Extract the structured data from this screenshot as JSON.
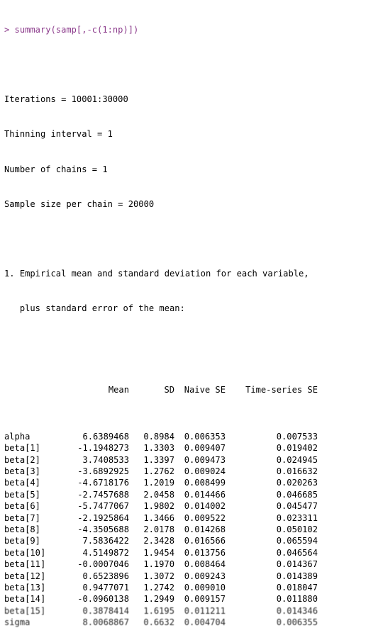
{
  "command": "> summary(samp[,-c(1:np)])",
  "header": [
    "Iterations = 10001:30000",
    "Thinning interval = 1",
    "Number of chains = 1",
    "Sample size per chain = 20000"
  ],
  "section": {
    "line1": "1. Empirical mean and standard deviation for each variable,",
    "line2": "   plus standard error of the mean:"
  },
  "table": {
    "columns": [
      "",
      "Mean",
      "SD",
      "Naive SE",
      "Time-series SE"
    ],
    "rows": [
      [
        "alpha",
        "6.6389468",
        "0.8984",
        "0.006353",
        "0.007533"
      ],
      [
        "beta[1]",
        "-1.1948273",
        "1.3303",
        "0.009407",
        "0.019402"
      ],
      [
        "beta[2]",
        "3.7408533",
        "1.3397",
        "0.009473",
        "0.024945"
      ],
      [
        "beta[3]",
        "-3.6892925",
        "1.2762",
        "0.009024",
        "0.016632"
      ],
      [
        "beta[4]",
        "-4.6718176",
        "1.2019",
        "0.008499",
        "0.020263"
      ],
      [
        "beta[5]",
        "-2.7457688",
        "2.0458",
        "0.014466",
        "0.046685"
      ],
      [
        "beta[6]",
        "-5.7477067",
        "1.9802",
        "0.014002",
        "0.045477"
      ],
      [
        "beta[7]",
        "-2.1925864",
        "1.3466",
        "0.009522",
        "0.023311"
      ],
      [
        "beta[8]",
        "-4.3505688",
        "2.0178",
        "0.014268",
        "0.050102"
      ],
      [
        "beta[9]",
        "7.5836422",
        "2.3428",
        "0.016566",
        "0.065594"
      ],
      [
        "beta[10]",
        "4.5149872",
        "1.9454",
        "0.013756",
        "0.046564"
      ],
      [
        "beta[11]",
        "-0.0007046",
        "1.1970",
        "0.008464",
        "0.014367"
      ],
      [
        "beta[12]",
        "0.6523896",
        "1.3072",
        "0.009243",
        "0.014389"
      ],
      [
        "beta[13]",
        "0.9477071",
        "1.2742",
        "0.009010",
        "0.018047"
      ],
      [
        "beta[14]",
        "-0.0960138",
        "1.2949",
        "0.009157",
        "0.011880"
      ],
      [
        "beta[15]",
        "0.3878414",
        "1.6195",
        "0.011211",
        "0.014346"
      ],
      [
        "sigma",
        "8.0068867",
        "0.6632",
        "0.004704",
        "0.006355"
      ]
    ]
  }
}
